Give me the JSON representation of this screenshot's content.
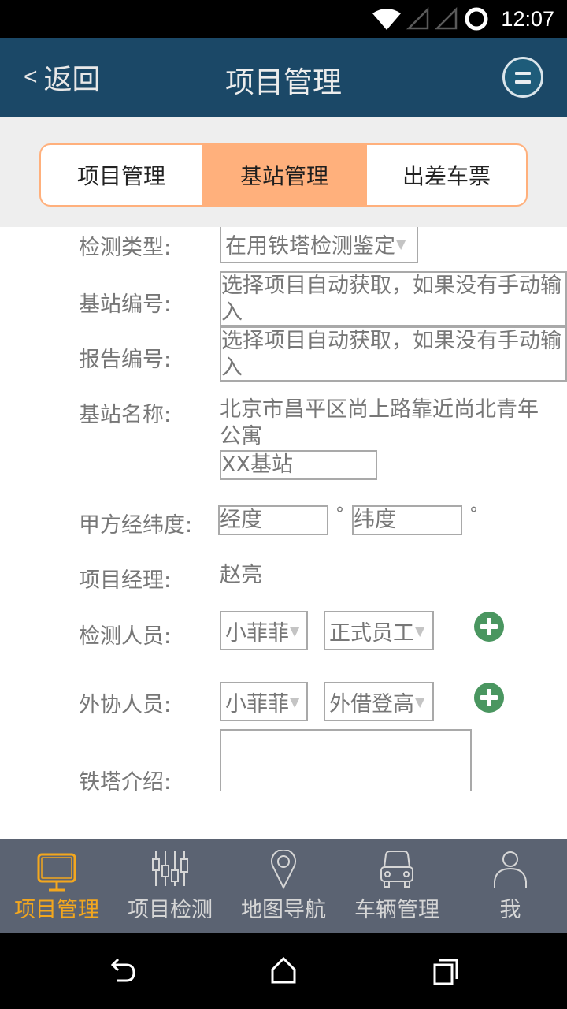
{
  "status_bar": {
    "time": "12:07",
    "icons": [
      "wifi-icon",
      "signal-icon",
      "signal-icon",
      "circle-status-icon"
    ]
  },
  "header": {
    "back_label": "返回",
    "back_chevron": "<",
    "title": "项目管理",
    "menu_icon": "menu-circle-icon"
  },
  "tabs": [
    {
      "label": "项目管理",
      "active": false
    },
    {
      "label": "基站管理",
      "active": true
    },
    {
      "label": "出差车票",
      "active": false
    }
  ],
  "form": {
    "detect_type": {
      "label": "检测类型:",
      "value": "在用铁塔检测鉴定"
    },
    "station_no": {
      "label": "基站编号:",
      "placeholder": "选择项目自动获取，如果没有手动输入"
    },
    "report_no": {
      "label": "报告编号:",
      "placeholder": "选择项目自动获取，如果没有手动输入"
    },
    "station_name": {
      "label": "基站名称:",
      "address": "北京市昌平区尚上路靠近尚北青年公寓",
      "name_value": "XX基站"
    },
    "coords": {
      "label": "甲方经纬度:",
      "lng_placeholder": "经度",
      "lat_placeholder": "纬度",
      "unit": "°"
    },
    "manager": {
      "label": "项目经理:",
      "value": "赵亮"
    },
    "inspectors": {
      "label": "检测人员:",
      "person": "小菲菲",
      "type": "正式员工"
    },
    "external": {
      "label": "外协人员:",
      "person": "小菲菲",
      "type": "外借登高"
    },
    "tower_intro": {
      "label": "铁塔介绍:",
      "value": ""
    }
  },
  "bottom_nav": [
    {
      "label": "项目管理",
      "icon": "monitor-icon",
      "active": true
    },
    {
      "label": "项目检测",
      "icon": "sliders-icon",
      "active": false
    },
    {
      "label": "地图导航",
      "icon": "map-pin-icon",
      "active": false
    },
    {
      "label": "车辆管理",
      "icon": "car-icon",
      "active": false
    },
    {
      "label": "我",
      "icon": "user-icon",
      "active": false
    }
  ],
  "colors": {
    "header_bg": "#1b4867",
    "tab_accent": "#ffb07c",
    "nav_bg": "#5b6372",
    "nav_active": "#f3a71e",
    "add_button": "#4a9660"
  }
}
